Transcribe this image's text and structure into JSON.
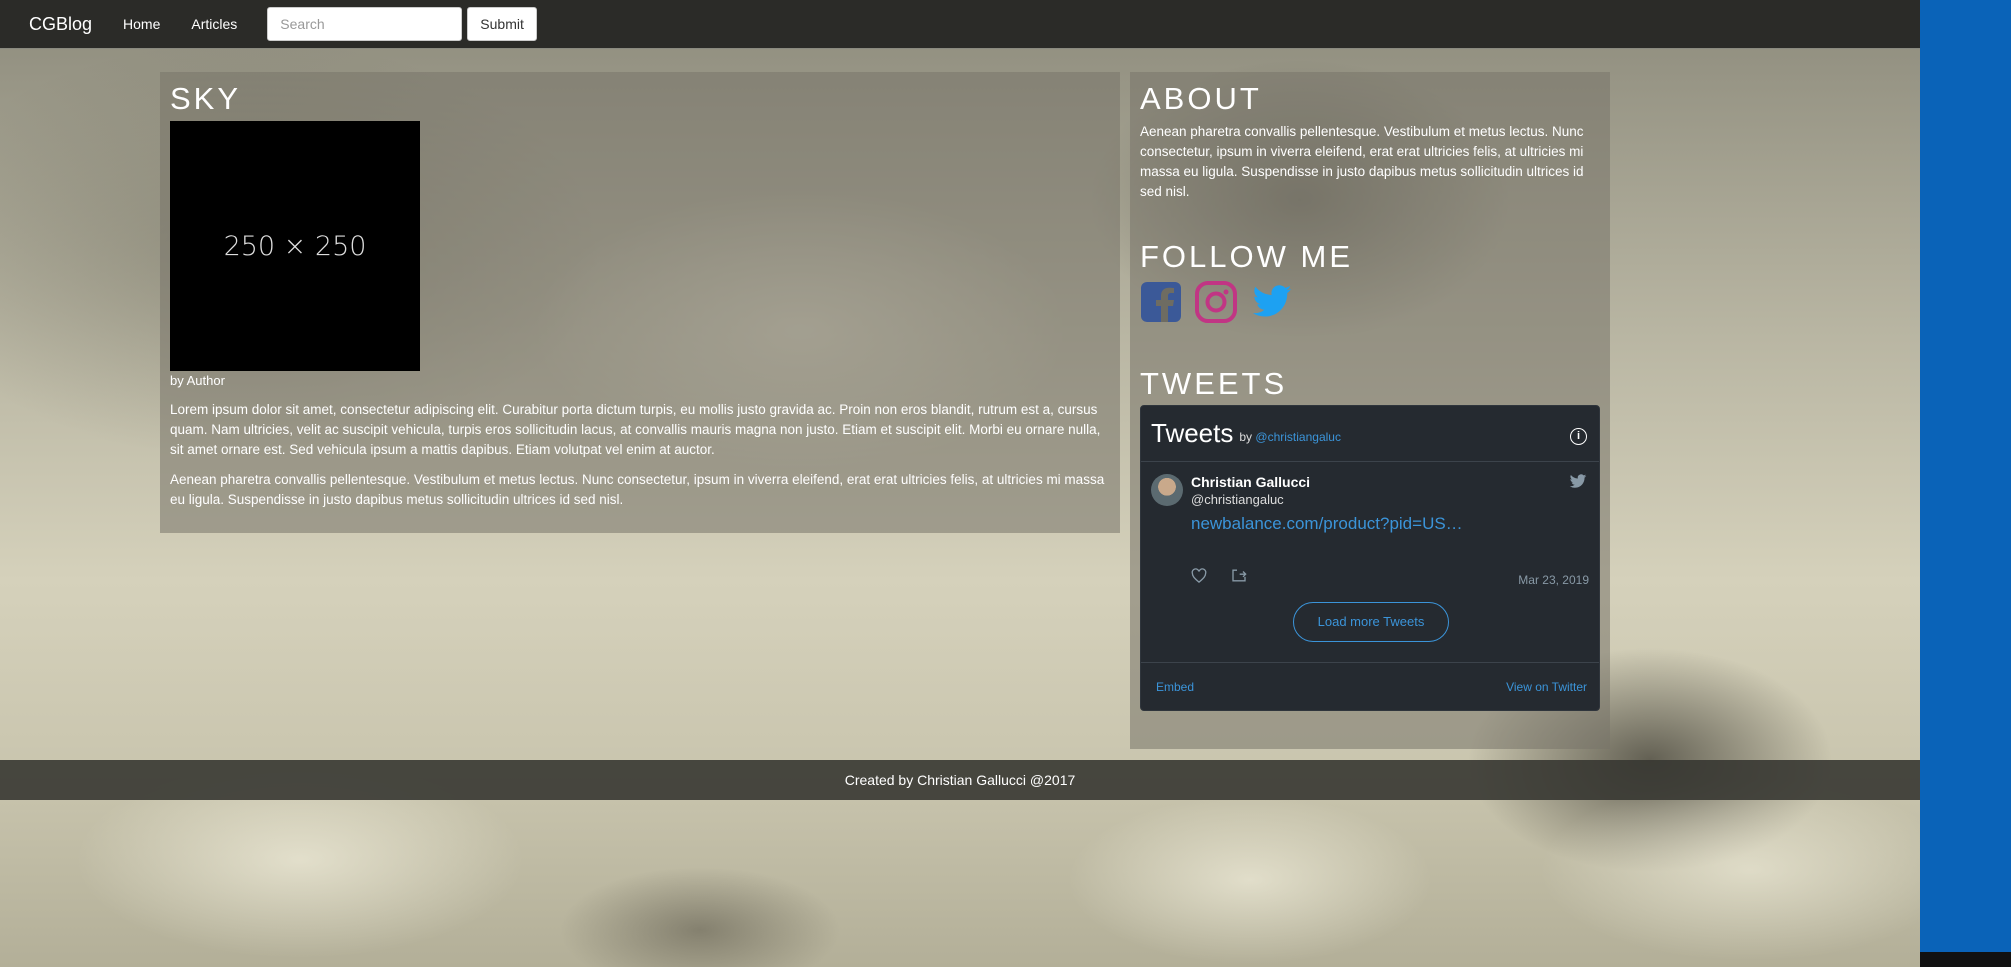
{
  "navbar": {
    "brand": "CGBlog",
    "links": [
      "Home",
      "Articles"
    ],
    "search_placeholder": "Search",
    "submit_label": "Submit"
  },
  "article": {
    "title": "SKY",
    "image_label": "250 × 250",
    "byline": "by Author",
    "paragraphs": [
      "Lorem ipsum dolor sit amet, consectetur adipiscing elit. Curabitur porta dictum turpis, eu mollis justo gravida ac. Proin non eros blandit, rutrum est a, cursus quam. Nam ultricies, velit ac suscipit vehicula, turpis eros sollicitudin lacus, at convallis mauris magna non justo. Etiam et suscipit elit. Morbi eu ornare nulla, sit amet ornare est. Sed vehicula ipsum a mattis dapibus. Etiam volutpat vel enim at auctor.",
      "Aenean pharetra convallis pellentesque. Vestibulum et metus lectus. Nunc consectetur, ipsum in viverra eleifend, erat erat ultricies felis, at ultricies mi massa eu ligula. Suspendisse in justo dapibus metus sollicitudin ultrices id sed nisl."
    ]
  },
  "sidebar": {
    "about_title": "ABOUT",
    "about_text": "Aenean pharetra convallis pellentesque. Vestibulum et metus lectus. Nunc consectetur, ipsum in viverra eleifend, erat erat ultricies felis, at ultricies mi massa eu ligula. Suspendisse in justo dapibus metus sollicitudin ultrices id sed nisl.",
    "follow_title": "FOLLOW ME",
    "social": [
      {
        "icon": "facebook-icon",
        "color": "#3b5998"
      },
      {
        "icon": "instagram-icon",
        "color": "#c13584"
      },
      {
        "icon": "twitter-icon",
        "color": "#1da1f2"
      }
    ],
    "tweets_title": "TWEETS"
  },
  "twitter_widget": {
    "title": "Tweets",
    "by": "by",
    "handle": "@christiangaluc",
    "tweet": {
      "name": "Christian Gallucci",
      "username": "@christiangaluc",
      "link": "newbalance.com/product?pid=US…",
      "date": "Mar 23, 2019"
    },
    "load_more": "Load more Tweets",
    "embed": "Embed",
    "view_on_twitter": "View on Twitter"
  },
  "footer": {
    "text": "Created by Christian Gallucci @2017"
  },
  "colors": {
    "navbar_bg": "#2b2b28",
    "accent_blue": "#0a63b8",
    "twitter_link": "#3b94d9"
  }
}
